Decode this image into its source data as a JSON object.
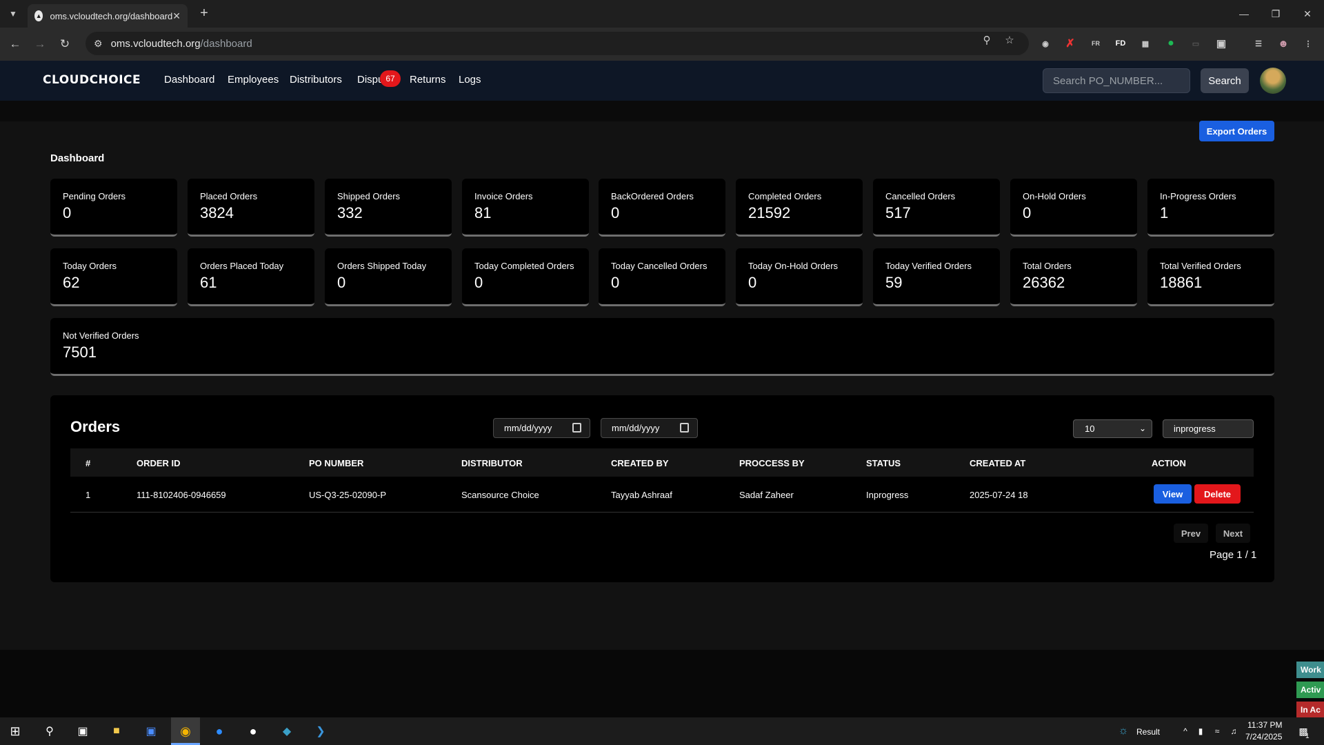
{
  "browser": {
    "tab_title": "oms.vcloudtech.org/dashboard",
    "url_host": "oms.vcloudtech.org",
    "url_path": "/dashboard",
    "extension_labels": {
      "fd": "FD",
      "fr": "FR"
    }
  },
  "app": {
    "logo": "CLOUDCHOICE",
    "nav": [
      "Dashboard",
      "Employees",
      "Distributors",
      "Dispu",
      "Returns",
      "Logs"
    ],
    "disputes_badge": "67",
    "search_placeholder": "Search PO_NUMBER...",
    "search_button": "Search",
    "export_button": "Export Orders",
    "dashboard_title": "Dashboard"
  },
  "stats": [
    {
      "label": "Pending Orders",
      "value": "0"
    },
    {
      "label": "Placed Orders",
      "value": "3824"
    },
    {
      "label": "Shipped Orders",
      "value": "332"
    },
    {
      "label": "Invoice Orders",
      "value": "81"
    },
    {
      "label": "BackOrdered Orders",
      "value": "0"
    },
    {
      "label": "Completed Orders",
      "value": "21592"
    },
    {
      "label": "Cancelled Orders",
      "value": "517"
    },
    {
      "label": "On-Hold Orders",
      "value": "0"
    },
    {
      "label": "In-Progress Orders",
      "value": "1"
    },
    {
      "label": "Today Orders",
      "value": "62"
    },
    {
      "label": "Orders Placed Today",
      "value": "61"
    },
    {
      "label": "Orders Shipped Today",
      "value": "0"
    },
    {
      "label": "Today Completed Orders",
      "value": "0"
    },
    {
      "label": "Today Cancelled Orders",
      "value": "0"
    },
    {
      "label": "Today On-Hold Orders",
      "value": "0"
    },
    {
      "label": "Today Verified Orders",
      "value": "59"
    },
    {
      "label": "Total Orders",
      "value": "26362"
    },
    {
      "label": "Total Verified Orders",
      "value": "18861"
    },
    {
      "label": "Not Verified Orders",
      "value": "7501"
    }
  ],
  "orders": {
    "title": "Orders",
    "date_from_placeholder": "mm/dd/yyyy",
    "date_to_placeholder": "mm/dd/yyyy",
    "page_size": "10",
    "status_filter": "inprogress",
    "columns": [
      "#",
      "ORDER ID",
      "PO NUMBER",
      "DISTRIBUTOR",
      "CREATED BY",
      "PROCCESS BY",
      "STATUS",
      "CREATED AT",
      "ACTION"
    ],
    "rows": [
      {
        "index": "1",
        "order_id": "111-8102406-0946659",
        "po_number": "US-Q3-25-02090-P",
        "distributor": "Scansource Choice",
        "created_by": "Tayyab Ashraaf",
        "processed_by": "Sadaf Zaheer",
        "status": "Inprogress",
        "created_at": "2025-07-24 18"
      }
    ],
    "view_label": "View",
    "delete_label": "Delete",
    "prev_label": "Prev",
    "next_label": "Next",
    "page_info": "Page 1 / 1"
  },
  "side_tabs": [
    "Work",
    "Activ",
    "In Ac"
  ],
  "taskbar": {
    "weather_label": "Result",
    "time": "11:37 PM",
    "date": "7/24/2025",
    "notification_count": "1"
  },
  "colors": {
    "accent_blue": "#1a5fe0",
    "danger_red": "#e3171b",
    "nav_bg": "#0e1726"
  }
}
